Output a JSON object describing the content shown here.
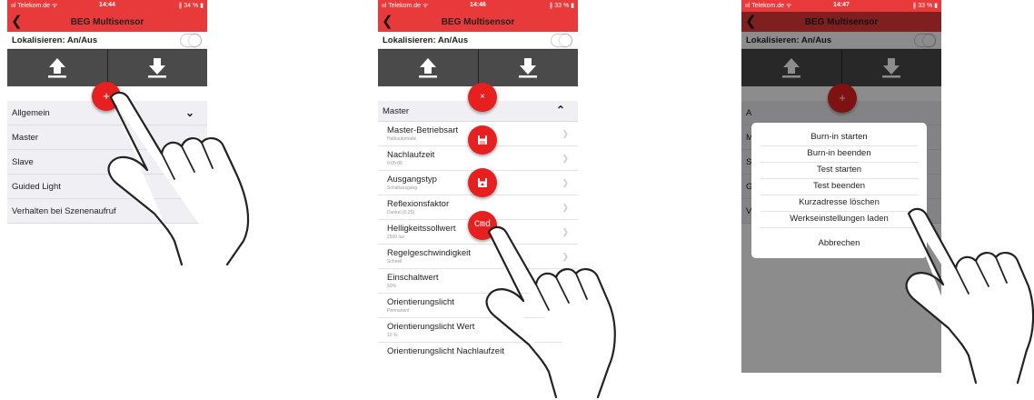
{
  "colors": {
    "accent": "#e83a3a",
    "fab": "#e81f1f",
    "toolbar": "#4a4a4a",
    "list_header_bg": "#efeff4"
  },
  "screens": [
    {
      "status": {
        "carrier": "ııl Telekom.de ᯤ",
        "time": "14:44",
        "battery": "∦ 34 % ▮"
      },
      "nav": {
        "title": "BEG Multisensor"
      },
      "locate_label": "Lokalisieren: An/Aus",
      "fab_icon": "plus-icon",
      "header": {
        "label": "Allgemein"
      },
      "rows": [
        "Master",
        "Slave",
        "Guided Light",
        "Verhalten bei Szenenaufruf"
      ]
    },
    {
      "status": {
        "carrier": "ııl Telekom.de ᯤ",
        "time": "14:46",
        "battery": "∦ 33 % ▮"
      },
      "nav": {
        "title": "BEG Multisensor"
      },
      "locate_label": "Lokalisieren: An/Aus",
      "header": {
        "label": "Master"
      },
      "fabs": {
        "close": "×",
        "cmd": "Cmd"
      },
      "rows": [
        {
          "title": "Master-Betriebsart",
          "value": "Halbautomatik"
        },
        {
          "title": "Nachlaufzeit",
          "value": "0:05:00"
        },
        {
          "title": "Ausgangstyp",
          "value": "Schaltausgang"
        },
        {
          "title": "Reflexionsfaktor",
          "value": "Dunkel (0,25)"
        },
        {
          "title": "Helligkeitssollwert",
          "value": "2500 lux"
        },
        {
          "title": "Regelgeschwindigkeit",
          "value": "Schnell"
        },
        {
          "title": "Einschaltwert",
          "value": "50%"
        },
        {
          "title": "Orientierungslicht",
          "value": "Permanent"
        },
        {
          "title": "Orientierungslicht Wert",
          "value": "10 %"
        },
        {
          "title": "Orientierungslicht Nachlaufzeit",
          "value": ""
        }
      ]
    },
    {
      "status": {
        "carrier": "ııl Telekom.de ᯤ",
        "time": "14:47",
        "battery": "∦ 33 % ▮"
      },
      "nav": {
        "title": "BEG Multisensor"
      },
      "locate_label": "Lokalisieren: An/Aus",
      "fab_label": "+",
      "behind_rows": [
        "A",
        "M",
        "S",
        "G",
        "V"
      ],
      "menu": [
        "Burn-in starten",
        "Burn-in beenden",
        "Test starten",
        "Test beenden",
        "Kurzadresse löschen",
        "Werkseinstellungen laden"
      ],
      "cancel": "Abbrechen"
    }
  ]
}
